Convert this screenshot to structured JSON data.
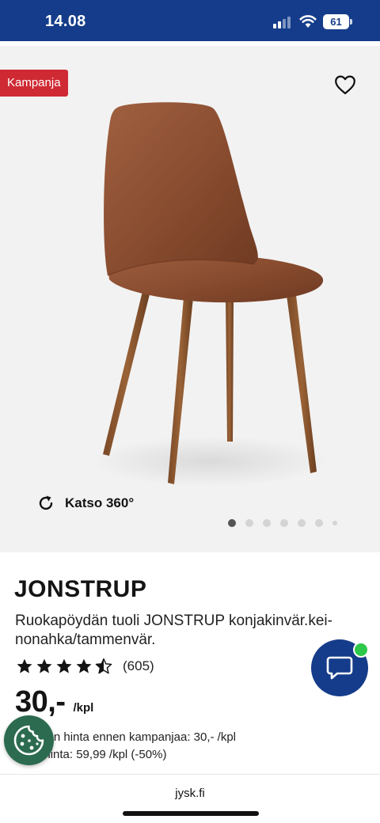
{
  "status_bar": {
    "time": "14.08",
    "battery": "61"
  },
  "gallery": {
    "badge": "Kampanja",
    "view360_label": "Katso 360°",
    "dot_count": 7,
    "active_dot": 0
  },
  "product": {
    "name": "JONSTRUP",
    "description": "Ruokapöydän tuoli JONSTRUP konjakinvär.kei-nonahka/tammenvär.",
    "rating": 4.5,
    "rating_count": "(605)",
    "price": "30,-",
    "price_unit": "/kpl",
    "lowest_price_text": "päivän hinta ennen kampanjaa: 30,- /kpl",
    "normal_price_text": "aalihinta: 59,99 /kpl (-50%)"
  },
  "browser": {
    "url": "jysk.fi"
  },
  "colors": {
    "brand_blue": "#143c8a",
    "campaign_red": "#cf2a34",
    "online_green": "#2ec84a",
    "cookie_green": "#2c6b4f"
  },
  "icons": {
    "wishlist": "heart-outline-icon",
    "view360": "rotate-icon",
    "chat": "chat-bubble-icon",
    "cookie": "cookie-icon"
  }
}
